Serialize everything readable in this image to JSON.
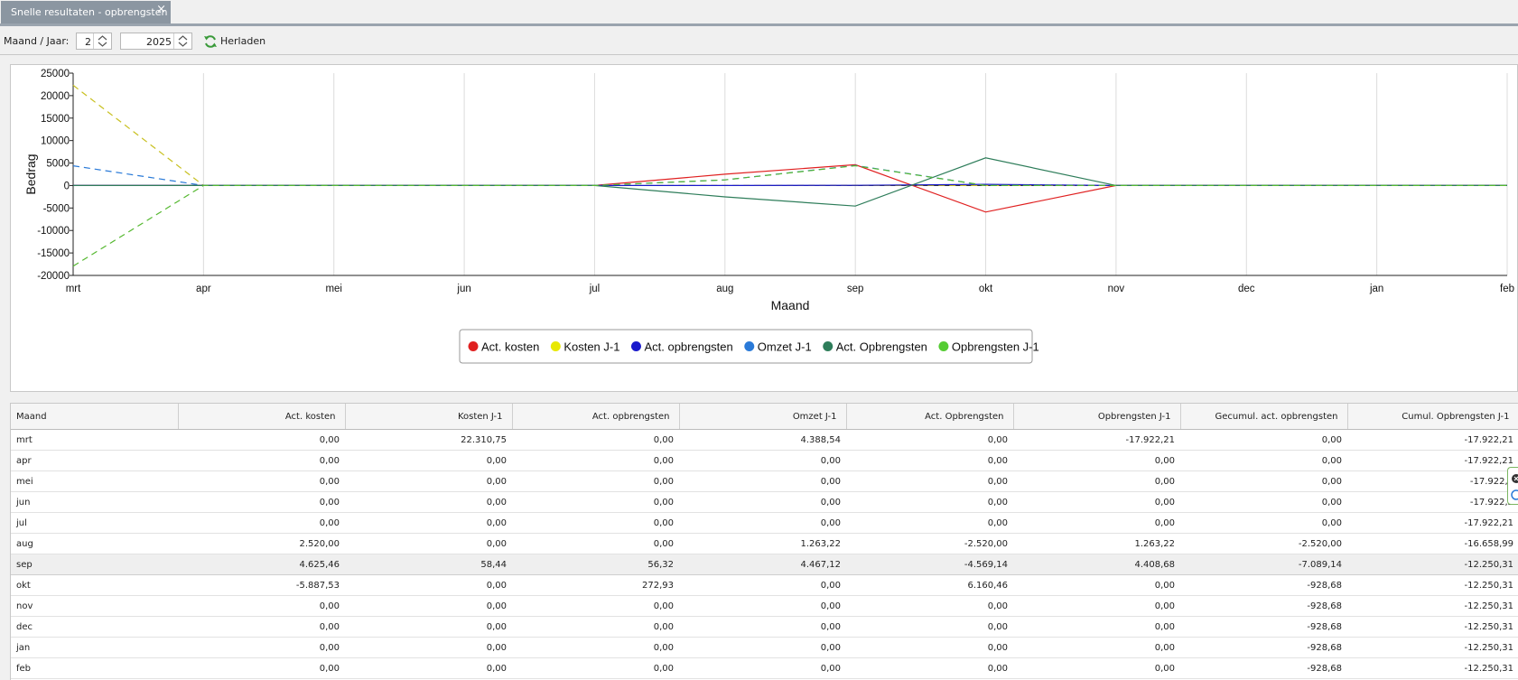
{
  "tab": {
    "title": "Snelle resultaten - opbrengsten",
    "close_glyph": "×"
  },
  "toolbar": {
    "label": "Maand / Jaar:",
    "month": "2",
    "year": "2025",
    "reload_label": "Herladen",
    "reload_icon": "refresh-icon"
  },
  "chart_data": {
    "type": "line",
    "xlabel": "Maand",
    "ylabel": "Bedrag",
    "categories": [
      "mrt",
      "apr",
      "mei",
      "jun",
      "jul",
      "aug",
      "sep",
      "okt",
      "nov",
      "dec",
      "jan",
      "feb"
    ],
    "ylim": [
      -20000,
      25000
    ],
    "yticks": [
      "25000",
      "20000",
      "15000",
      "10000",
      "5000",
      "0",
      "-5000",
      "-10000",
      "-15000",
      "-20000"
    ],
    "grid": "vertical",
    "legend_position": "bottom",
    "series": [
      {
        "name": "Act. kosten",
        "color": "#e02020",
        "dashed": false,
        "values": [
          0,
          0,
          0,
          0,
          0,
          2520,
          4625.46,
          -5887.53,
          0,
          0,
          0,
          0
        ]
      },
      {
        "name": "Kosten J-1",
        "color": "#c8c020",
        "dashed": true,
        "values": [
          22310.75,
          0,
          0,
          0,
          0,
          0,
          58.44,
          0,
          0,
          0,
          0,
          0
        ]
      },
      {
        "name": "Act. opbrengsten",
        "color": "#1a1acc",
        "dashed": false,
        "values": [
          0,
          0,
          0,
          0,
          0,
          0,
          56.32,
          272.93,
          0,
          0,
          0,
          0
        ]
      },
      {
        "name": "Omzet J-1",
        "color": "#2a7ad8",
        "dashed": true,
        "values": [
          4388.54,
          0,
          0,
          0,
          0,
          1263.22,
          4467.12,
          0,
          0,
          0,
          0,
          0
        ]
      },
      {
        "name": "Act. Opbrengsten",
        "color": "#2e7d5a",
        "dashed": false,
        "values": [
          0,
          0,
          0,
          0,
          0,
          -2520,
          -4569.14,
          6160.46,
          0,
          0,
          0,
          0
        ]
      },
      {
        "name": "Opbrengsten J-1",
        "color": "#55b830",
        "dashed": true,
        "values": [
          -17922.21,
          0,
          0,
          0,
          0,
          1263.22,
          4408.68,
          0,
          0,
          0,
          0,
          0
        ]
      }
    ]
  },
  "legend_colors": [
    "#e02020",
    "#e8e800",
    "#1a1acc",
    "#2a7ad8",
    "#2e7d5a",
    "#55cc33"
  ],
  "table": {
    "columns": [
      "Maand",
      "Act. kosten",
      "Kosten J-1",
      "Act. opbrengsten",
      "Omzet J-1",
      "Act. Opbrengsten",
      "Opbrengsten J-1",
      "Gecumul. act. opbrengsten",
      "Cumul. Opbrengsten J-1"
    ],
    "rows": [
      [
        "mrt",
        "0,00",
        "22.310,75",
        "0,00",
        "4.388,54",
        "0,00",
        "-17.922,21",
        "0,00",
        "-17.922,21"
      ],
      [
        "apr",
        "0,00",
        "0,00",
        "0,00",
        "0,00",
        "0,00",
        "0,00",
        "0,00",
        "-17.922,21"
      ],
      [
        "mei",
        "0,00",
        "0,00",
        "0,00",
        "0,00",
        "0,00",
        "0,00",
        "0,00",
        "-17.922,2"
      ],
      [
        "jun",
        "0,00",
        "0,00",
        "0,00",
        "0,00",
        "0,00",
        "0,00",
        "0,00",
        "-17.922,2"
      ],
      [
        "jul",
        "0,00",
        "0,00",
        "0,00",
        "0,00",
        "0,00",
        "0,00",
        "0,00",
        "-17.922,21"
      ],
      [
        "aug",
        "2.520,00",
        "0,00",
        "0,00",
        "1.263,22",
        "-2.520,00",
        "1.263,22",
        "-2.520,00",
        "-16.658,99"
      ],
      [
        "sep",
        "4.625,46",
        "58,44",
        "56,32",
        "4.467,12",
        "-4.569,14",
        "4.408,68",
        "-7.089,14",
        "-12.250,31"
      ],
      [
        "okt",
        "-5.887,53",
        "0,00",
        "272,93",
        "0,00",
        "6.160,46",
        "0,00",
        "-928,68",
        "-12.250,31"
      ],
      [
        "nov",
        "0,00",
        "0,00",
        "0,00",
        "0,00",
        "0,00",
        "0,00",
        "-928,68",
        "-12.250,31"
      ],
      [
        "dec",
        "0,00",
        "0,00",
        "0,00",
        "0,00",
        "0,00",
        "0,00",
        "-928,68",
        "-12.250,31"
      ],
      [
        "jan",
        "0,00",
        "0,00",
        "0,00",
        "0,00",
        "0,00",
        "0,00",
        "-928,68",
        "-12.250,31"
      ],
      [
        "feb",
        "0,00",
        "0,00",
        "0,00",
        "0,00",
        "0,00",
        "0,00",
        "-928,68",
        "-12.250,31"
      ]
    ],
    "selected_row": 6
  }
}
